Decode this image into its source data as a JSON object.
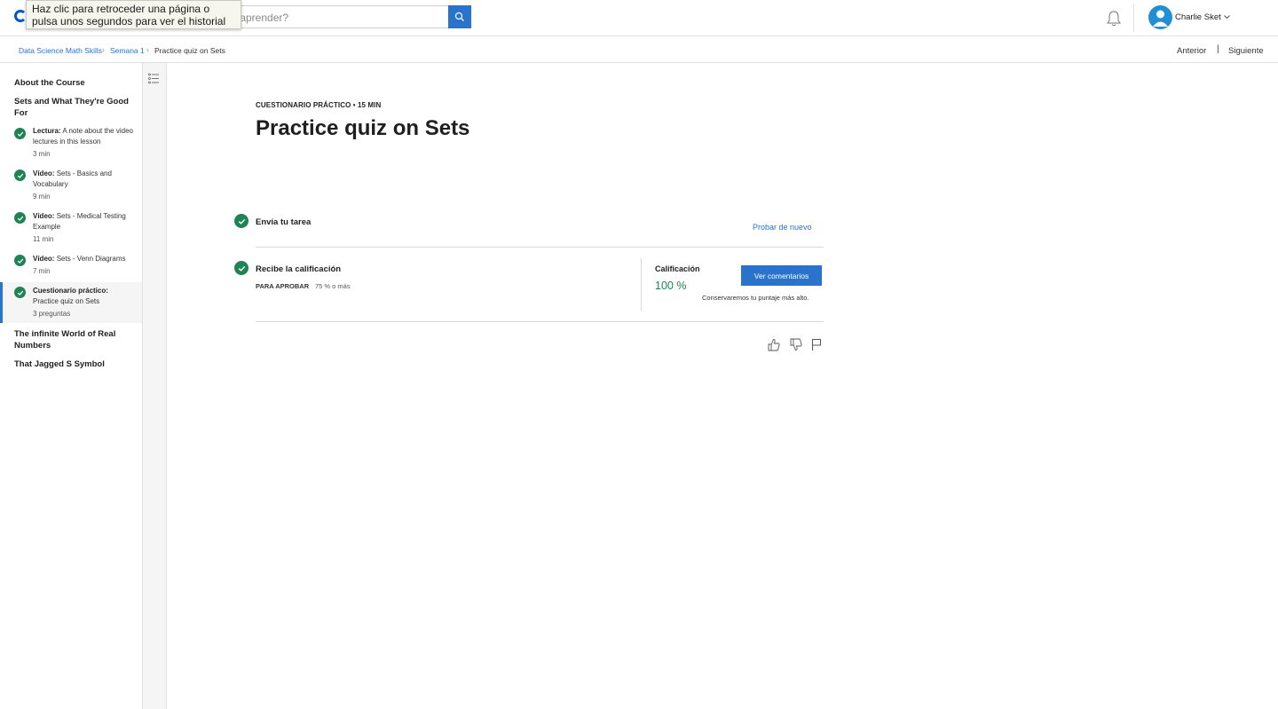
{
  "header": {
    "search_placeholder": "¿Qué quieres aprender?",
    "search_visible_text": "s aprender?",
    "tooltip_text": "Haz clic para retroceder una página o pulsa unos segundos para ver el historial",
    "user_name": "Charlie Sket"
  },
  "breadcrumb": {
    "items": [
      "Data Science Math Skills",
      "Semana 1",
      "Practice quiz on Sets"
    ],
    "separator": "›"
  },
  "nav": {
    "prev": "Anterior",
    "separator": "|",
    "next": "Siguiente"
  },
  "sidebar": {
    "sections": [
      {
        "title": "About the Course"
      },
      {
        "title": "Sets and What They're Good For"
      },
      {
        "title": "The infinite World of Real Numbers"
      },
      {
        "title": "That Jagged S Symbol"
      }
    ],
    "items": [
      {
        "type": "Lectura:",
        "name": "A note about the video lectures in this lesson",
        "duration": "3 min"
      },
      {
        "type": "Vídeo:",
        "name": "Sets - Basics and Vocabulary",
        "duration": "9 min"
      },
      {
        "type": "Vídeo:",
        "name": "Sets - Medical Testing Example",
        "duration": "11 min"
      },
      {
        "type": "Vídeo:",
        "name": "Sets - Venn Diagrams",
        "duration": "7 min"
      },
      {
        "type": "Cuestionario práctico:",
        "name": "Practice quiz on Sets",
        "duration": "3 preguntas"
      }
    ]
  },
  "main": {
    "kicker": "CUESTIONARIO PRÁCTICO • 15 MIN",
    "title": "Practice quiz on Sets",
    "step1": {
      "label": "Envía tu tarea",
      "action": "Probar de nuevo"
    },
    "step2": {
      "label": "Recibe la calificación",
      "pass_label": "PARA APROBAR",
      "pass_value": "75 % o más",
      "grade_label": "Calificación",
      "grade_value": "100 %",
      "feedback_button": "Ver comentarios",
      "keep_note": "Conservaremos tu puntaje más alto."
    }
  },
  "colors": {
    "accent": "#2a73cc",
    "success": "#1f8354",
    "avatar": "#1f8fd6"
  },
  "icons": [
    "search-icon",
    "bell-icon",
    "user-icon",
    "chevron-down-icon",
    "outline-icon",
    "check-icon",
    "thumbs-up-icon",
    "thumbs-down-icon",
    "flag-icon"
  ]
}
